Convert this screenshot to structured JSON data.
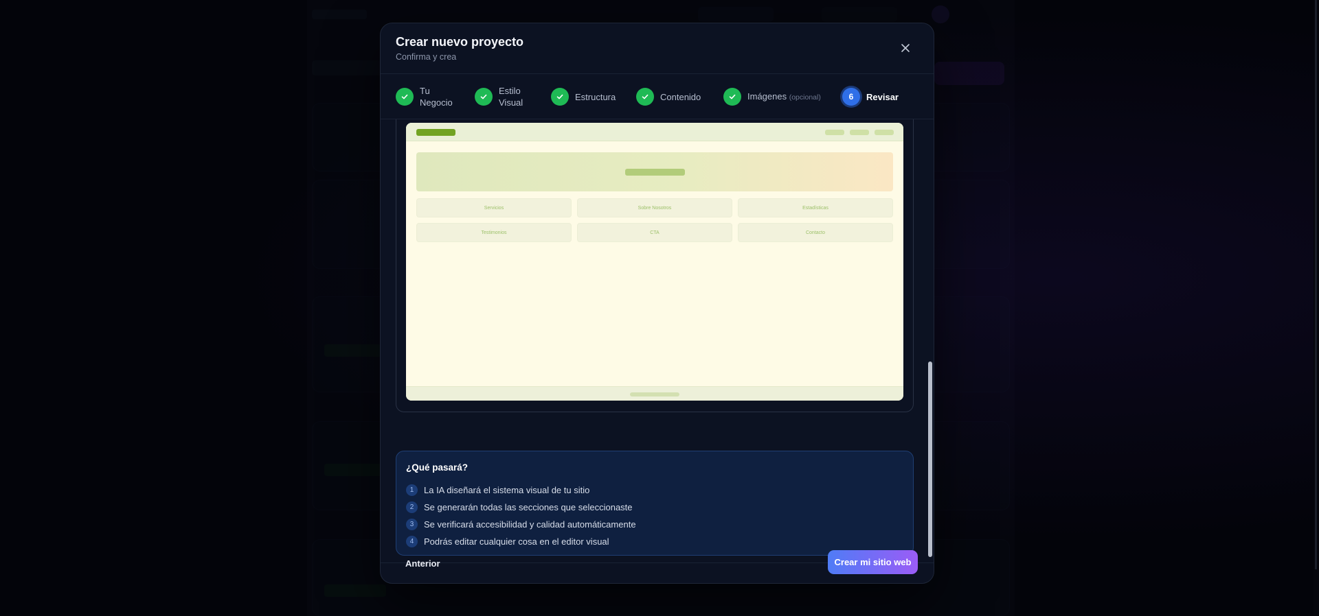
{
  "modal": {
    "title": "Crear nuevo proyecto",
    "subtitle": "Confirma y crea",
    "close_icon": "close-icon"
  },
  "stepper": {
    "steps": [
      {
        "label_line1": "Tu",
        "label_line2": "Negocio",
        "status": "done"
      },
      {
        "label_line1": "Estilo",
        "label_line2": "Visual",
        "status": "done"
      },
      {
        "label": "Estructura",
        "status": "done"
      },
      {
        "label": "Contenido",
        "status": "done"
      },
      {
        "label": "Imágenes",
        "optional": "(opcional)",
        "status": "done"
      },
      {
        "number": "6",
        "label": "Revisar",
        "status": "active"
      }
    ]
  },
  "preview": {
    "sections": [
      "Servicios",
      "Sobre Nosotros",
      "Estadísticas",
      "Testimonios",
      "CTA",
      "Contacto"
    ]
  },
  "info": {
    "title": "¿Qué pasará?",
    "items": [
      {
        "num": "1",
        "text": "La IA diseñará el sistema visual de tu sitio"
      },
      {
        "num": "2",
        "text": "Se generarán todas las secciones que seleccionaste"
      },
      {
        "num": "3",
        "text": "Se verificará accesibilidad y calidad automáticamente"
      },
      {
        "num": "4",
        "text": "Podrás editar cualquier cosa en el editor visual"
      }
    ]
  },
  "footer": {
    "prev_label": "Anterior",
    "create_label": "Crear mi sitio web"
  },
  "colors": {
    "accent_start": "#4f7cf6",
    "accent_end": "#9b5cf6",
    "step_done": "#1fba55",
    "step_active": "#2f6fe8"
  }
}
